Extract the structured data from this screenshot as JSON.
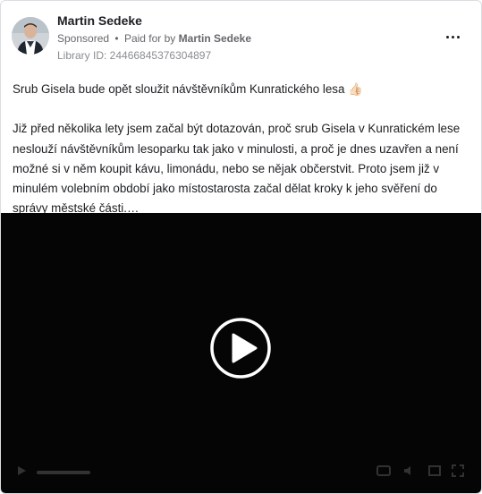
{
  "post": {
    "author": "Martin Sedeke",
    "sponsored_label": "Sponsored",
    "separator": "•",
    "paid_for_prefix": "Paid for by",
    "paid_for_name": "Martin Sedeke",
    "library_id": "Library ID: 24466845376304897"
  },
  "content": {
    "title": "Srub Gisela bude opět sloužit návštěvníkům Kunratického lesa 👍🏻",
    "body": "Již před několika lety jsem začal být dotazován, proč srub Gisela v Kunratickém lese neslouží návštěvníkům lesoparku tak jako v minulosti, a proč je dnes uzavřen a není možné si v něm koupit kávu, limonádu, nebo se nějak občerstvit. Proto jsem již v minulém volebním období jako místostarosta začal dělat kroky k jeho svěření do správy městské části.…"
  },
  "video": {
    "play_icon": "play-icon",
    "background": "#050505"
  },
  "colors": {
    "text_primary": "#1c1e21",
    "text_secondary": "#65676b",
    "border": "#dadde1"
  }
}
